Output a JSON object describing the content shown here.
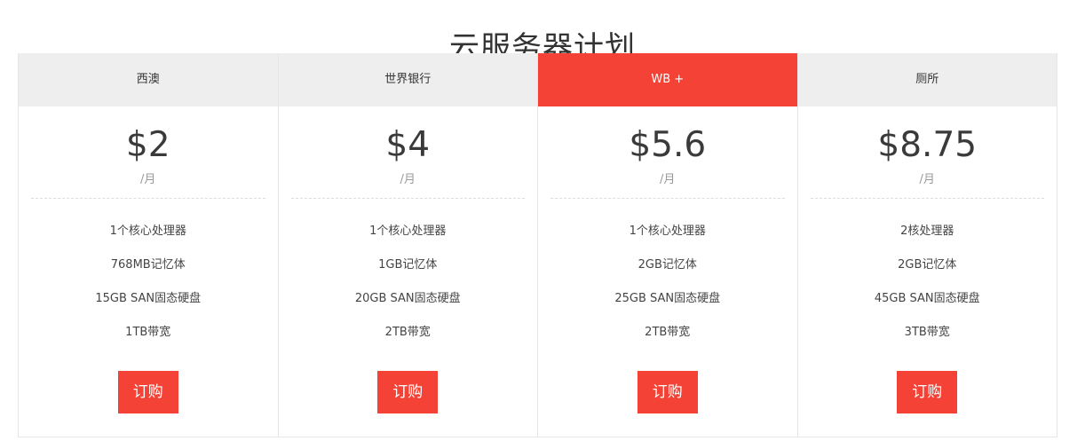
{
  "page": {
    "title": "云服务器计划"
  },
  "colors": {
    "accent": "#f44336",
    "header_bg": "#eeeeee",
    "text": "#333333",
    "muted": "#999999"
  },
  "plans": [
    {
      "name": "西澳",
      "featured": false,
      "price": "$2",
      "period": "/月",
      "features": [
        "1个核心处理器",
        "768MB记忆体",
        "15GB SAN固态硬盘",
        "1TB带宽"
      ],
      "button_label": "订购"
    },
    {
      "name": "世界银行",
      "featured": false,
      "price": "$4",
      "period": "/月",
      "features": [
        "1个核心处理器",
        "1GB记忆体",
        "20GB SAN固态硬盘",
        "2TB带宽"
      ],
      "button_label": "订购"
    },
    {
      "name": "WB +",
      "featured": true,
      "price": "$5.6",
      "period": "/月",
      "features": [
        "1个核心处理器",
        "2GB记忆体",
        "25GB SAN固态硬盘",
        "2TB带宽"
      ],
      "button_label": "订购"
    },
    {
      "name": "厕所",
      "featured": false,
      "price": "$8.75",
      "period": "/月",
      "features": [
        "2核处理器",
        "2GB记忆体",
        "45GB SAN固态硬盘",
        "3TB带宽"
      ],
      "button_label": "订购"
    }
  ]
}
